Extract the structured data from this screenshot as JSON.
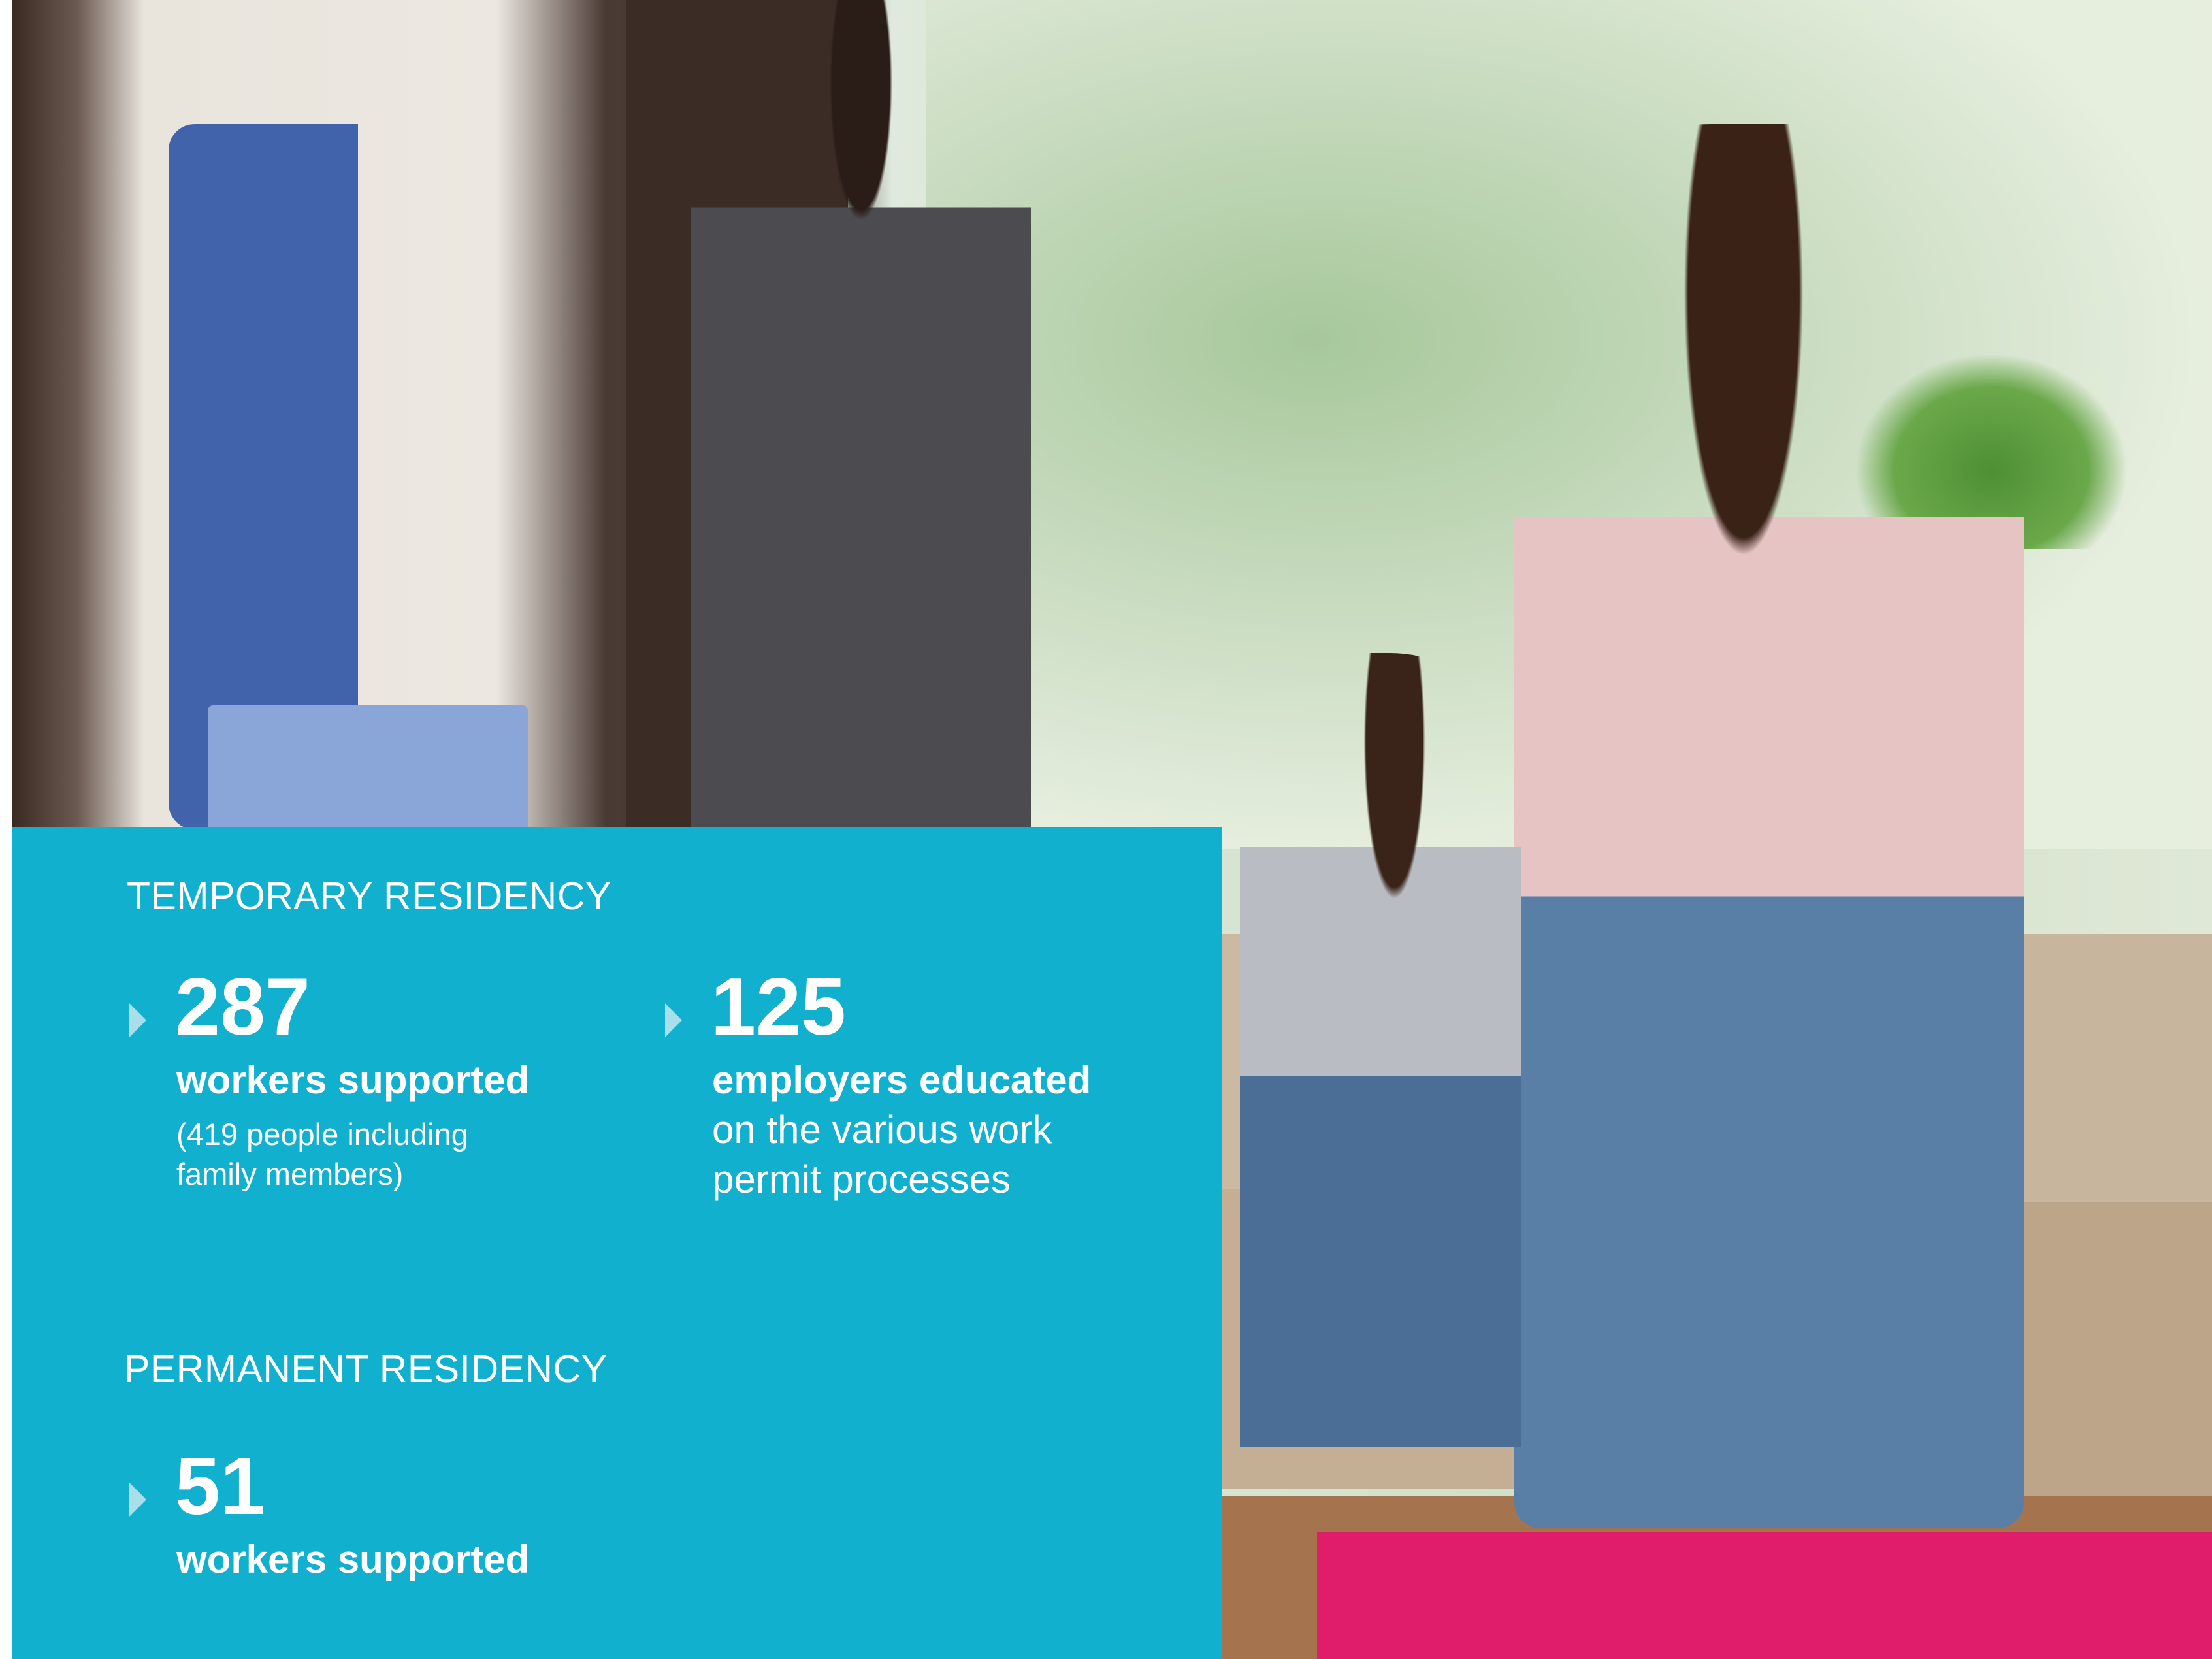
{
  "temporary": {
    "heading": "TEMPORARY RESIDENCY",
    "stats": [
      {
        "number": "287",
        "label_bold": "workers supported",
        "label_detail_line1": "(419 people including",
        "label_detail_line2": "family members)"
      },
      {
        "number": "125",
        "label_bold": "employers educated",
        "label_line2": "on the various work",
        "label_line3": "permit processes"
      }
    ]
  },
  "permanent": {
    "heading": "PERMANENT RESIDENCY",
    "stats": [
      {
        "number": "51",
        "label_bold": "workers supported"
      }
    ]
  },
  "colors": {
    "panel": "#12b0cf",
    "accent": "#e01d6a",
    "arrow": "#a9dfeb"
  },
  "photo": {
    "icon": "family-photo"
  }
}
